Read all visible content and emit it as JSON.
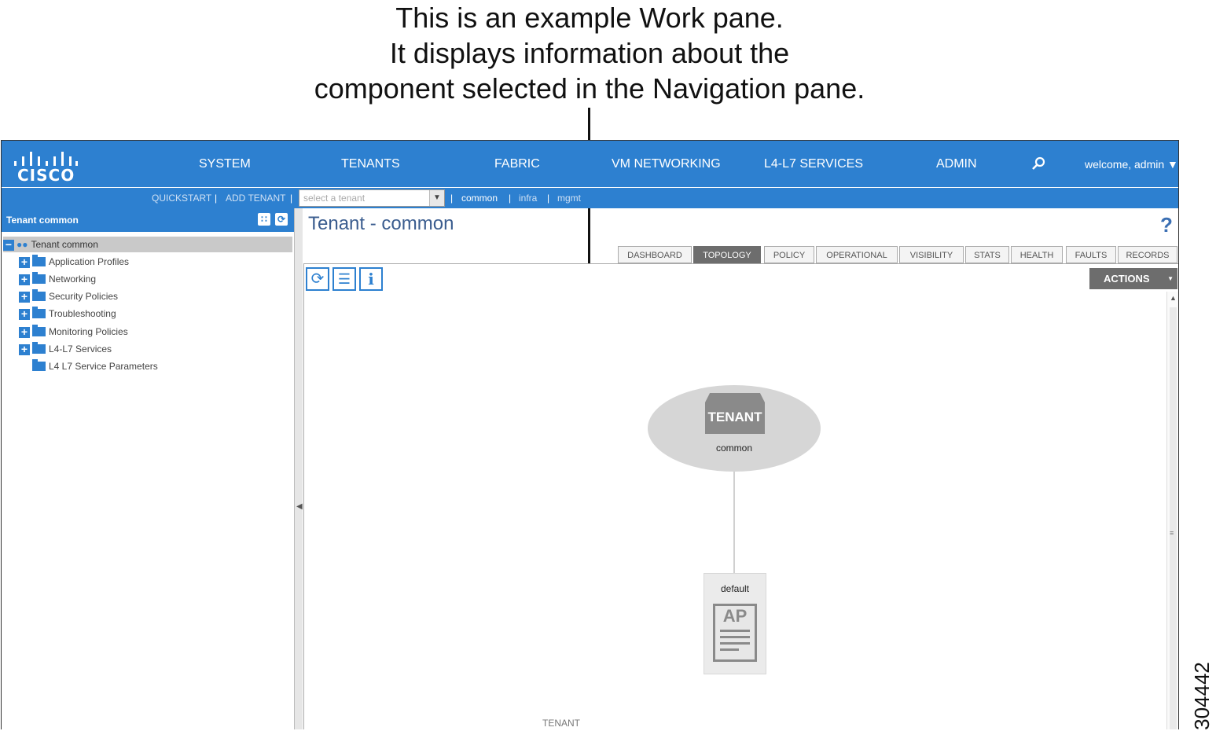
{
  "caption": {
    "line1": "This is an example Work pane.",
    "line2": "It displays information about the",
    "line3": "component selected in the Navigation pane."
  },
  "figure_id": "304442",
  "brand": {
    "logo_text": "CISCO",
    "accent": "#2d80d0"
  },
  "topnav": {
    "items": [
      {
        "label": "SYSTEM"
      },
      {
        "label": "TENANTS"
      },
      {
        "label": "FABRIC"
      },
      {
        "label": "VM NETWORKING"
      },
      {
        "label": "L4-L7 SERVICES"
      },
      {
        "label": "ADMIN"
      }
    ],
    "active": "TENANTS",
    "search_icon": "search-icon",
    "welcome": "welcome, admin ▼"
  },
  "subnav": {
    "quickstart": "QUICKSTART",
    "add_tenant": "ADD TENANT",
    "select_placeholder": "select a tenant",
    "tenants": [
      "common",
      "infra",
      "mgmt"
    ],
    "sep": "|"
  },
  "nav_pane": {
    "title": "Tenant common",
    "root": "Tenant common",
    "items": [
      {
        "label": "Application Profiles",
        "expandable": true
      },
      {
        "label": "Networking",
        "expandable": true
      },
      {
        "label": "Security Policies",
        "expandable": true
      },
      {
        "label": "Troubleshooting",
        "expandable": true
      },
      {
        "label": "Monitoring Policies",
        "expandable": true
      },
      {
        "label": "L4-L7 Services",
        "expandable": true
      },
      {
        "label": "L4 L7 Service Parameters",
        "expandable": false
      }
    ]
  },
  "work_pane": {
    "title": "Tenant - common",
    "help": "?",
    "tabs": [
      "DASHBOARD",
      "TOPOLOGY",
      "POLICY",
      "OPERATIONAL",
      "VISIBILITY",
      "STATS",
      "HEALTH",
      "FAULTS",
      "RECORDS"
    ],
    "active_tab": "TOPOLOGY",
    "actions": "ACTIONS",
    "toolbar": [
      "refresh-icon",
      "list-icon",
      "info-icon"
    ],
    "topology": {
      "tenant_badge": "TENANT",
      "tenant_name": "common",
      "ap_name": "default",
      "ap_badge": "AP",
      "bottom_label": "TENANT"
    }
  }
}
